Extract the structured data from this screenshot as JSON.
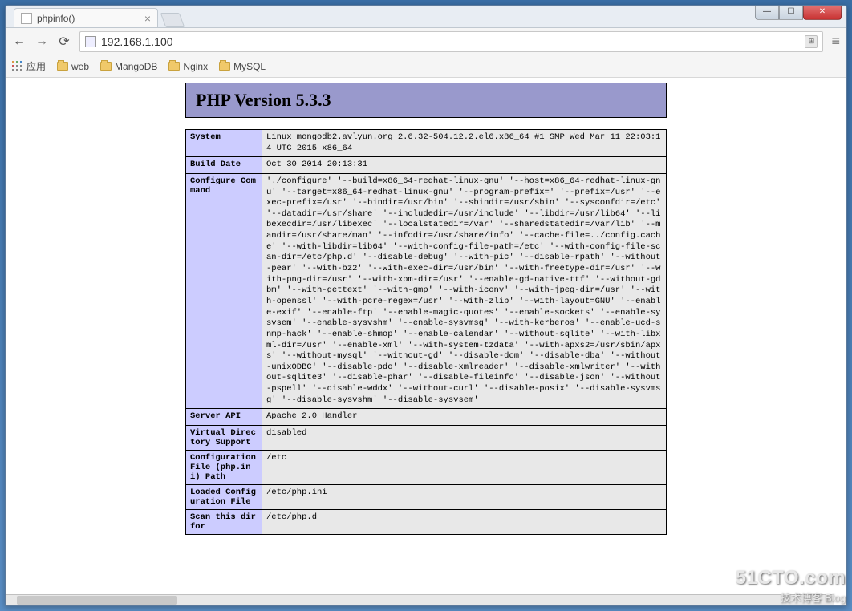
{
  "window": {
    "tab_title": "phpinfo()",
    "url": "192.168.1.100"
  },
  "bookmarks": {
    "apps_label": "应用",
    "items": [
      "web",
      "MangoDB",
      "Nginx",
      "MySQL"
    ]
  },
  "phpinfo": {
    "header": "PHP Version 5.3.3",
    "rows": [
      {
        "label": "System",
        "value": "Linux mongodb2.avlyun.org 2.6.32-504.12.2.el6.x86_64 #1 SMP Wed Mar 11 22:03:14 UTC 2015 x86_64"
      },
      {
        "label": "Build Date",
        "value": "Oct 30 2014 20:13:31"
      },
      {
        "label": "Configure Command",
        "value": "'./configure' '--build=x86_64-redhat-linux-gnu' '--host=x86_64-redhat-linux-gnu' '--target=x86_64-redhat-linux-gnu' '--program-prefix=' '--prefix=/usr' '--exec-prefix=/usr' '--bindir=/usr/bin' '--sbindir=/usr/sbin' '--sysconfdir=/etc' '--datadir=/usr/share' '--includedir=/usr/include' '--libdir=/usr/lib64' '--libexecdir=/usr/libexec' '--localstatedir=/var' '--sharedstatedir=/var/lib' '--mandir=/usr/share/man' '--infodir=/usr/share/info' '--cache-file=../config.cache' '--with-libdir=lib64' '--with-config-file-path=/etc' '--with-config-file-scan-dir=/etc/php.d' '--disable-debug' '--with-pic' '--disable-rpath' '--without-pear' '--with-bz2' '--with-exec-dir=/usr/bin' '--with-freetype-dir=/usr' '--with-png-dir=/usr' '--with-xpm-dir=/usr' '--enable-gd-native-ttf' '--without-gdbm' '--with-gettext' '--with-gmp' '--with-iconv' '--with-jpeg-dir=/usr' '--with-openssl' '--with-pcre-regex=/usr' '--with-zlib' '--with-layout=GNU' '--enable-exif' '--enable-ftp' '--enable-magic-quotes' '--enable-sockets' '--enable-sysvsem' '--enable-sysvshm' '--enable-sysvmsg' '--with-kerberos' '--enable-ucd-snmp-hack' '--enable-shmop' '--enable-calendar' '--without-sqlite' '--with-libxml-dir=/usr' '--enable-xml' '--with-system-tzdata' '--with-apxs2=/usr/sbin/apxs' '--without-mysql' '--without-gd' '--disable-dom' '--disable-dba' '--without-unixODBC' '--disable-pdo' '--disable-xmlreader' '--disable-xmlwriter' '--without-sqlite3' '--disable-phar' '--disable-fileinfo' '--disable-json' '--without-pspell' '--disable-wddx' '--without-curl' '--disable-posix' '--disable-sysvmsg' '--disable-sysvshm' '--disable-sysvsem'"
      },
      {
        "label": "Server API",
        "value": "Apache 2.0 Handler"
      },
      {
        "label": "Virtual Directory Support",
        "value": "disabled"
      },
      {
        "label": "Configuration File (php.ini) Path",
        "value": "/etc"
      },
      {
        "label": "Loaded Configuration File",
        "value": "/etc/php.ini"
      },
      {
        "label": "Scan this dir for",
        "value": "/etc/php.d"
      }
    ]
  },
  "watermark": {
    "line1": "51CTO.com",
    "line2": "技术博客   Blog"
  }
}
